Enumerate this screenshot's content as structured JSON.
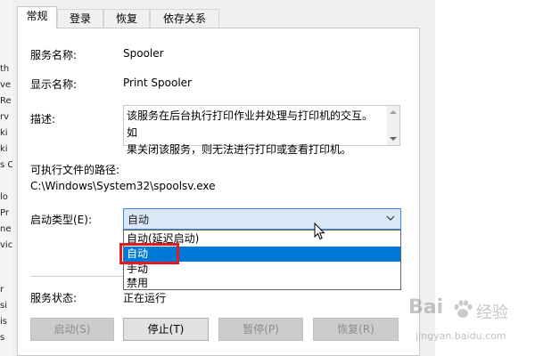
{
  "tabs": [
    "常规",
    "登录",
    "恢复",
    "依存关系"
  ],
  "fields": {
    "service_name_label": "服务名称:",
    "service_name_value": "Spooler",
    "display_name_label": "显示名称:",
    "display_name_value": "Print Spooler",
    "description_label": "描述:",
    "description_line1": "该服务在后台执行打印作业并处理与打印机的交互。如",
    "description_line2": "果关闭该服务，则无法进行打印或查看打印机。",
    "path_label": "可执行文件的路径:",
    "path_value": "C:\\Windows\\System32\\spoolsv.exe",
    "startup_type_label": "启动类型(E):",
    "startup_type_value": "自动",
    "status_label": "服务状态:",
    "status_value": "正在运行"
  },
  "startup_options": [
    "自动(延迟启动)",
    "自动",
    "手动",
    "禁用"
  ],
  "selected_option_index": 1,
  "buttons": {
    "start": "启动(S)",
    "stop": "停止(T)",
    "pause": "暂停(P)",
    "resume": "恢复(R)"
  },
  "background_fragments": [
    "th",
    "ve",
    "Re",
    "rv",
    "ki",
    "ki",
    "s C",
    "lo",
    "Pr",
    "ne",
    "vic",
    "r",
    "si",
    "is",
    "s"
  ],
  "watermark": {
    "logo": "Bai",
    "logo2": "经验",
    "url": "jingyan.baidu.com"
  },
  "colors": {
    "selection": "#0078d7",
    "highlight_box": "#e21b22",
    "combo_bg": "#dbe8f8"
  }
}
